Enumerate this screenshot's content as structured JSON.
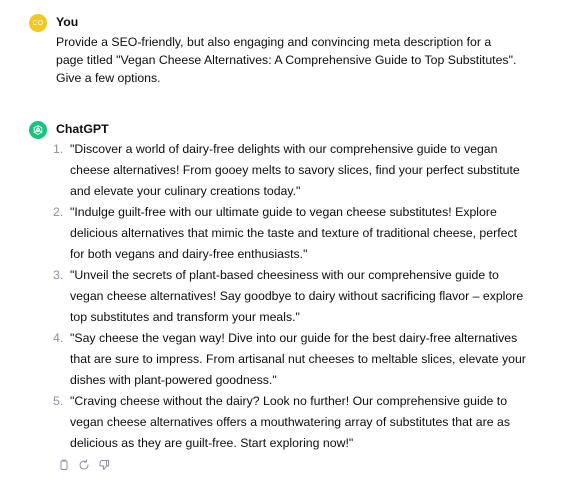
{
  "user_message": {
    "avatar_initials": "CO",
    "author": "You",
    "text": "Provide a SEO-friendly, but also engaging and convincing meta description for a page titled \"Vegan Cheese Alternatives: A Comprehensive Guide to Top Substitutes\". Give a few options."
  },
  "assistant_message": {
    "avatar_icon": "openai-logo-icon",
    "author": "ChatGPT",
    "items": [
      {
        "number": "1.",
        "text": "\"Discover a world of dairy-free delights with our comprehensive guide to vegan cheese alternatives! From gooey melts to savory slices, find your perfect substitute and elevate your culinary creations today.\""
      },
      {
        "number": "2.",
        "text": "\"Indulge guilt-free with our ultimate guide to vegan cheese substitutes! Explore delicious alternatives that mimic the taste and texture of traditional cheese, perfect for both vegans and dairy-free enthusiasts.\""
      },
      {
        "number": "3.",
        "text": "\"Unveil the secrets of plant-based cheesiness with our comprehensive guide to vegan cheese alternatives! Say goodbye to dairy without sacrificing flavor – explore top substitutes and transform your meals.\""
      },
      {
        "number": "4.",
        "text": "\"Say cheese the vegan way! Dive into our guide for the best dairy-free alternatives that are sure to impress. From artisanal nut cheeses to meltable slices, elevate your dishes with plant-powered goodness.\""
      },
      {
        "number": "5.",
        "text": "\"Craving cheese without the dairy? Look no further! Our comprehensive guide to vegan cheese alternatives offers a mouthwatering array of substitutes that are as delicious as they are guilt-free. Start exploring now!\""
      }
    ],
    "actions": [
      "copy-icon",
      "regenerate-icon",
      "thumbs-down-icon"
    ]
  },
  "colors": {
    "user_avatar": "#f2c81d",
    "assistant_avatar": "#19c37d",
    "text": "#0d0d0d",
    "muted": "#8e8ea0"
  }
}
